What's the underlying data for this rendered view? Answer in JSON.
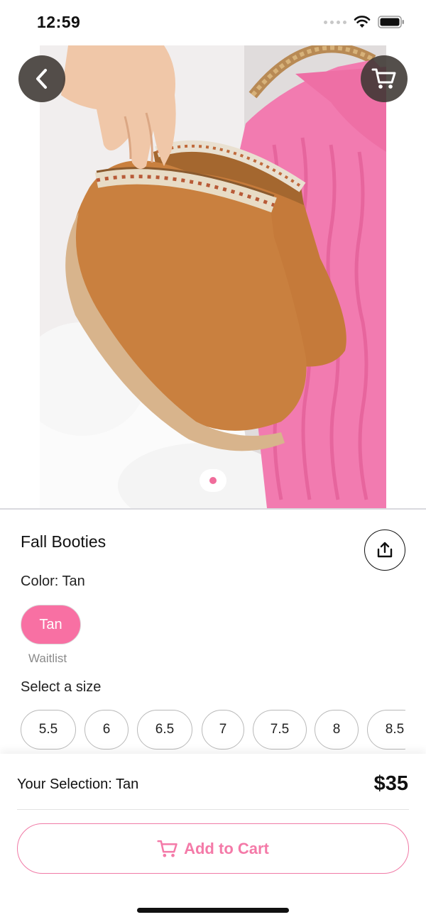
{
  "status_bar": {
    "time": "12:59"
  },
  "product": {
    "title": "Fall Booties",
    "color_label": "Color: Tan",
    "color_option": "Tan",
    "waitlist_label": "Waitlist",
    "size_label": "Select a size",
    "sizes": [
      "5.5",
      "6",
      "6.5",
      "7",
      "7.5",
      "8",
      "8.5"
    ],
    "image_pages": 1,
    "current_image": 1
  },
  "footer": {
    "selection": "Your Selection: Tan",
    "price": "$35",
    "add_to_cart": "Add to Cart"
  },
  "icons": {
    "back": "chevron-left-icon",
    "cart": "cart-icon",
    "share": "share-icon",
    "add_to_cart": "cart-icon"
  },
  "colors": {
    "accent_pink": "#f870a3",
    "button_text_pink": "#f47aa8",
    "nav_button_bg": "#3c3732"
  }
}
